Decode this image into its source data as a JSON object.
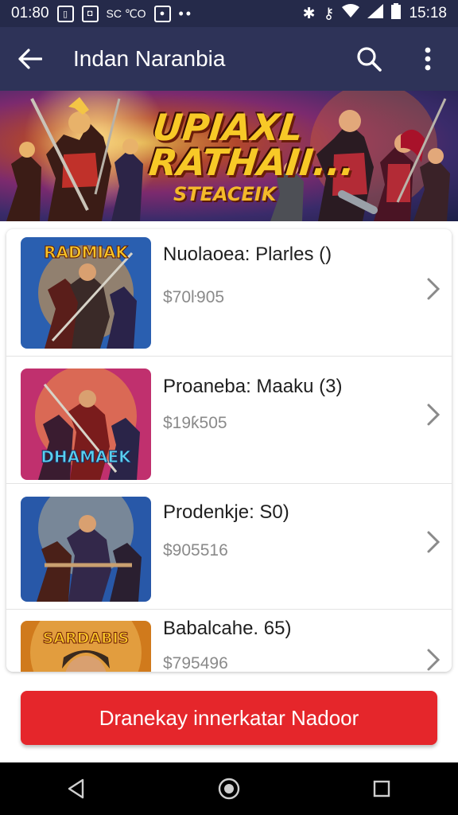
{
  "status_bar": {
    "time_left": "01:80",
    "mini_text": "SC ℃O",
    "time_right": "15:18",
    "icons": [
      "app-icon",
      "photo-icon",
      "more-dots-icon",
      "bluetooth-icon",
      "wifi-icon",
      "signal-icon",
      "battery-icon"
    ]
  },
  "app_bar": {
    "title": "Indan Naranbia",
    "back_icon": "arrow-left-icon",
    "search_icon": "search-icon",
    "menu_icon": "more-vertical-icon"
  },
  "banner": {
    "title_line1": "UPIAXL",
    "title_line2": "RATHAII...",
    "subtitle": "STEACEIK"
  },
  "items": [
    {
      "title": "Nuolaoea: Plarles ()",
      "price": "$70ŀ905",
      "thumb_text": "RADMIAK",
      "thumb_color": "#2a5fb0"
    },
    {
      "title": "Proaneba: Maaku (3)",
      "price": "$19ƙ505",
      "thumb_text": "DHAMAEK",
      "thumb_color": "#c0306e"
    },
    {
      "title": "Prodenkje: S0)",
      "price": "$905516",
      "thumb_text": "",
      "thumb_color": "#2858a8"
    },
    {
      "title": "Babalcahe. 65)",
      "price": "$795496",
      "thumb_text": "SARDABIS",
      "thumb_color": "#d07a1c"
    }
  ],
  "cta": {
    "label": "Dranekay innerkatar Nadoor",
    "color": "#e5262b"
  },
  "nav": {
    "icons": [
      "back-triangle-icon",
      "home-circle-icon",
      "recents-square-icon"
    ]
  }
}
